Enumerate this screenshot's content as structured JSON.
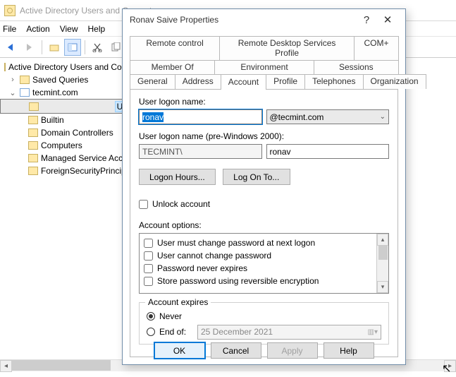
{
  "window": {
    "title": "Active Directory Users and Computers",
    "menu": {
      "file": "File",
      "action": "Action",
      "view": "View",
      "help": "Help"
    }
  },
  "tree": {
    "root": "Active Directory Users and Computers",
    "saved_queries": "Saved Queries",
    "domain": "tecmint.com",
    "children": [
      "Users",
      "Builtin",
      "Domain Controllers",
      "Computers",
      "Managed Service Accounts",
      "ForeignSecurityPrincipals"
    ]
  },
  "dialog": {
    "title": "Ronav Saive Properties",
    "tabs_row1": [
      "Remote control",
      "Remote Desktop Services Profile",
      "COM+"
    ],
    "tabs_row2": [
      "Member Of",
      "Environment",
      "Sessions"
    ],
    "tabs_row3": [
      "General",
      "Address",
      "Account",
      "Profile",
      "Telephones",
      "Organization"
    ],
    "active_tab": "Account",
    "logon_label": "User logon name:",
    "logon_value": "ronav",
    "logon_suffix": "@tecmint.com",
    "pre2000_label": "User logon name (pre-Windows 2000):",
    "pre2000_domain": "TECMINT\\",
    "pre2000_user": "ronav",
    "logon_hours_btn": "Logon Hours...",
    "logon_to_btn": "Log On To...",
    "unlock_label": "Unlock account",
    "account_options_label": "Account options:",
    "options": [
      "User must change password at next logon",
      "User cannot change password",
      "Password never expires",
      "Store password using reversible encryption"
    ],
    "expires_legend": "Account expires",
    "never_label": "Never",
    "endof_label": "End of:",
    "endof_date": "25 December 2021",
    "buttons": {
      "ok": "OK",
      "cancel": "Cancel",
      "apply": "Apply",
      "help": "Help"
    }
  }
}
